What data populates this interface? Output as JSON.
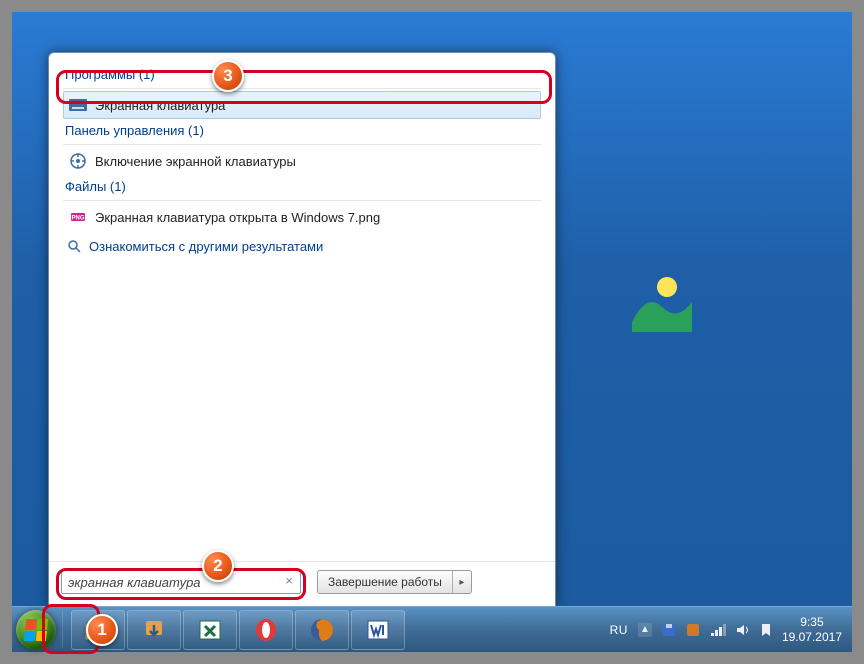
{
  "start_menu": {
    "categories": [
      {
        "header": "Программы (1)",
        "items": [
          {
            "label": "Экранная клавиатура",
            "icon": "keyboard-icon",
            "selected": true
          }
        ]
      },
      {
        "header": "Панель управления (1)",
        "items": [
          {
            "label": "Включение экранной клавиатуры",
            "icon": "ease-access-icon",
            "selected": false
          }
        ]
      },
      {
        "header": "Файлы (1)",
        "items": [
          {
            "label": "Экранная клавиатура открыта в Windows 7.png",
            "icon": "png-file-icon",
            "selected": false
          }
        ]
      }
    ],
    "more_results": "Ознакомиться с другими результатами",
    "search_value": "экранная клавиатура",
    "search_clear": "×",
    "shutdown_label": "Завершение работы"
  },
  "taskbar": {
    "apps": [
      {
        "name": "explorer",
        "color": "#f5c659"
      },
      {
        "name": "download",
        "color": "#3a8dd0"
      },
      {
        "name": "excel",
        "color": "#1d7044"
      },
      {
        "name": "opera",
        "color": "#e03a3a"
      },
      {
        "name": "firefox",
        "color": "#e07b1a"
      },
      {
        "name": "word",
        "color": "#2a579a"
      }
    ]
  },
  "tray": {
    "lang": "RU",
    "time": "9:35",
    "date": "19.07.2017"
  },
  "markers": {
    "m1": "1",
    "m2": "2",
    "m3": "3"
  }
}
